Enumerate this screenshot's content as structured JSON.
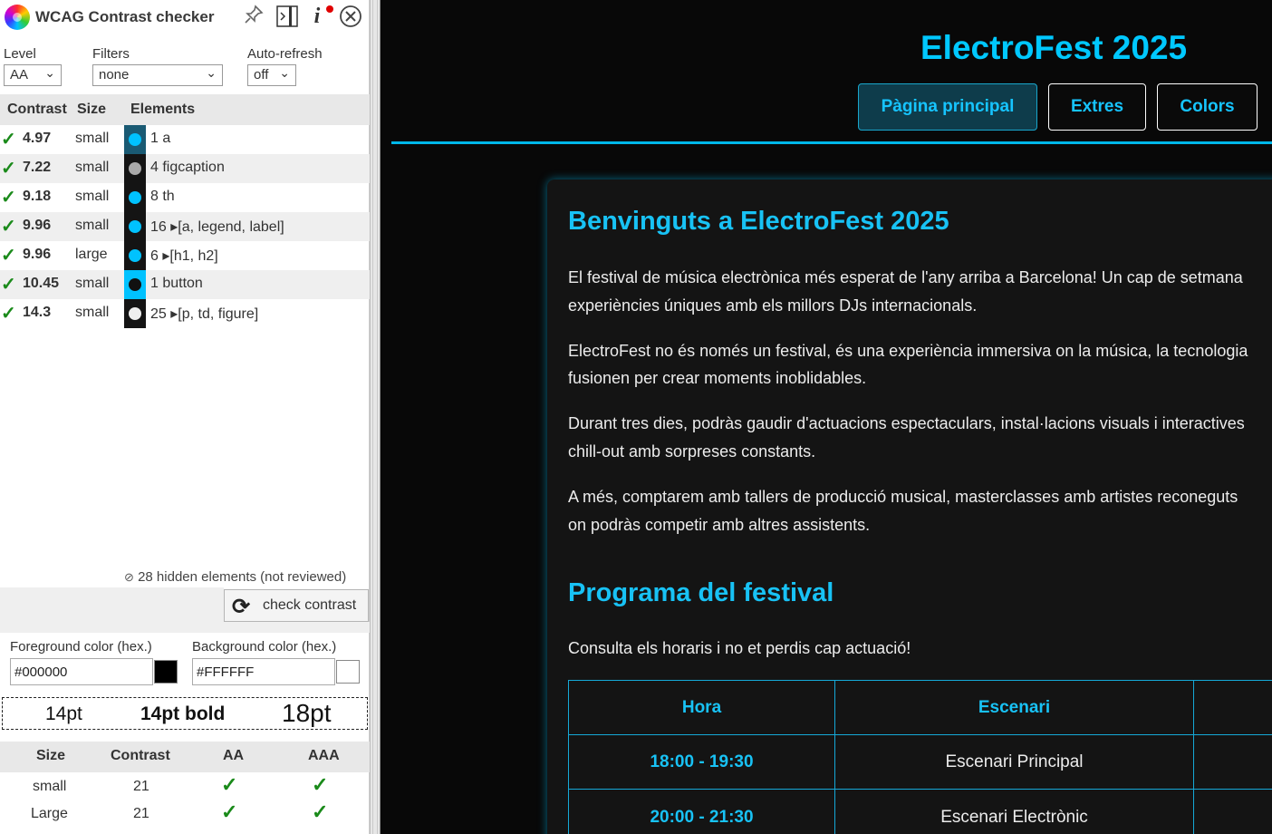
{
  "panel": {
    "title": "WCAG Contrast checker",
    "level_label": "Level",
    "level_value": "AA",
    "filters_label": "Filters",
    "filters_value": "none",
    "autorefresh_label": "Auto-refresh",
    "autorefresh_value": "off",
    "columns": {
      "contrast": "Contrast",
      "size": "Size",
      "elements": "Elements"
    },
    "results": [
      {
        "contrast": "4.97",
        "size": "small",
        "elements": "1 a",
        "swatch_bg": "#1a5a73",
        "swatch_fg": "#00c2ff"
      },
      {
        "contrast": "7.22",
        "size": "small",
        "elements": "4 figcaption",
        "swatch_bg": "#141414",
        "swatch_fg": "#aaaaaa"
      },
      {
        "contrast": "9.18",
        "size": "small",
        "elements": "8 th",
        "swatch_bg": "#141414",
        "swatch_fg": "#00c2ff"
      },
      {
        "contrast": "9.96",
        "size": "small",
        "elements": "16 ▸[a, legend, label]",
        "swatch_bg": "#141414",
        "swatch_fg": "#00c2ff"
      },
      {
        "contrast": "9.96",
        "size": "large",
        "elements": "6 ▸[h1, h2]",
        "swatch_bg": "#141414",
        "swatch_fg": "#00c2ff"
      },
      {
        "contrast": "10.45",
        "size": "small",
        "elements": "1 button",
        "swatch_bg": "#00c2ff",
        "swatch_fg": "#111111"
      },
      {
        "contrast": "14.3",
        "size": "small",
        "elements": "25 ▸[p, td, figure]",
        "swatch_bg": "#141414",
        "swatch_fg": "#eeeeee"
      }
    ],
    "hidden_note": "28 hidden elements (not reviewed)",
    "check_button": "check contrast",
    "fg_label": "Foreground color (hex.)",
    "fg_value": "#000000",
    "bg_label": "Background color (hex.)",
    "bg_value": "#FFFFFF",
    "preview": {
      "normal": "14pt",
      "bold": "14pt bold",
      "large": "18pt"
    },
    "result_columns": {
      "size": "Size",
      "contrast": "Contrast",
      "aa": "AA",
      "aaa": "AAA"
    },
    "result_rows": [
      {
        "size": "small",
        "contrast": "21"
      },
      {
        "size": "Large",
        "contrast": "21"
      }
    ]
  },
  "site": {
    "title": "ElectroFest 2025",
    "nav": [
      "Pàgina principal",
      "Extres",
      "Colors"
    ],
    "welcome_heading": "Benvinguts a ElectroFest 2025",
    "paragraphs": [
      "El festival de música electrònica més esperat de l'any arriba a Barcelona! Un cap de setmana",
      "experiències úniques amb els millors DJs internacionals.",
      "ElectroFest no és només un festival, és una experiència immersiva on la música, la tecnologia",
      "fusionen per crear moments inoblidables.",
      "Durant tres dies, podràs gaudir d'actuacions espectaculars, instal·lacions visuals i interactives",
      "chill-out amb sorpreses constants.",
      "A més, comptarem amb tallers de producció musical, masterclasses amb artistes reconeguts",
      "on podràs competir amb altres assistents."
    ],
    "program_heading": "Programa del festival",
    "program_intro": "Consulta els horaris i no et perdis cap actuació!",
    "table_headers": [
      "Hora",
      "Escenari"
    ],
    "table_rows": [
      [
        "18:00 - 19:30",
        "Escenari Principal"
      ],
      [
        "20:00 - 21:30",
        "Escenari Electrònic"
      ]
    ]
  }
}
